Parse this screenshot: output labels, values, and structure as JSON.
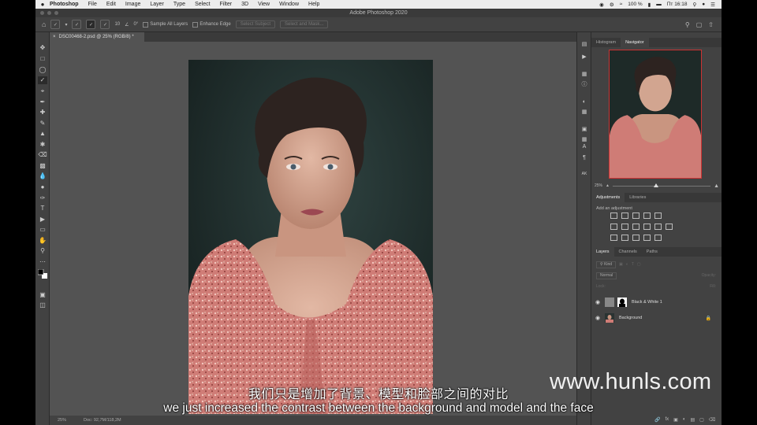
{
  "menubar": {
    "apple": "",
    "items": [
      "Photoshop",
      "File",
      "Edit",
      "Image",
      "Layer",
      "Type",
      "Select",
      "Filter",
      "3D",
      "View",
      "Window",
      "Help"
    ],
    "battery": "100 %",
    "clock": "Пт 16:18"
  },
  "window": {
    "title": "Adobe Photoshop 2020"
  },
  "options": {
    "brush_size": "10",
    "angle": "0°",
    "sample_all_layers": "Sample All Layers",
    "enhance_edge": "Enhance Edge",
    "select_subject": "Select Subject",
    "select_and_mask": "Select and Mask..."
  },
  "document": {
    "tab_label": "DSC00468-2.psd @ 25% (RGB/8) *"
  },
  "status": {
    "zoom": "25%",
    "doc": "Doc: 92,7M/118,2M"
  },
  "navigator": {
    "tabs": [
      "Histogram",
      "Navigator"
    ],
    "zoom": "25%"
  },
  "adjustments": {
    "tabs": [
      "Adjustments",
      "Libraries"
    ],
    "add_label": "Add an adjustment"
  },
  "layers": {
    "tabs": [
      "Layers",
      "Channels",
      "Paths"
    ],
    "kind": "Kind",
    "blend": "Normal",
    "opacity_label": "Opacity:",
    "lock_label": "Lock:",
    "fill_label": "Fill:",
    "items": [
      {
        "name": "Black & White 1"
      },
      {
        "name": "Background"
      }
    ]
  },
  "subtitles": {
    "cn": "我们只是增加了背景、模型和脸部之间的对比",
    "en": "we just increased the contrast between the background and model and the face"
  },
  "watermark": "www.hunls.com",
  "colors": {
    "accent_red": "#cc3333",
    "panel": "#424242",
    "canvas": "#535353"
  }
}
